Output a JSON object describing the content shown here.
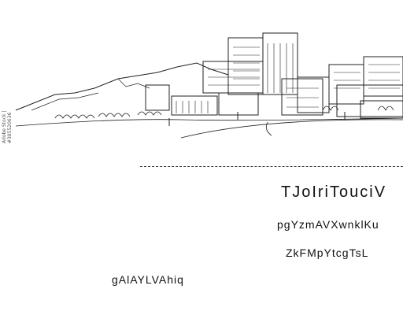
{
  "texts": {
    "heading": "TJoIriTouciV",
    "line1": "pgYzmAVXwnklKu",
    "line2": "ZkFMpYtcgTsL",
    "line3": "gAlAYLVAhiq"
  },
  "illustration": {
    "subject": "city skyline with mountains sketch",
    "credit": "Adobe Stock | #385520636"
  },
  "colors": {
    "ink": "#111111",
    "background": "#ffffff"
  }
}
